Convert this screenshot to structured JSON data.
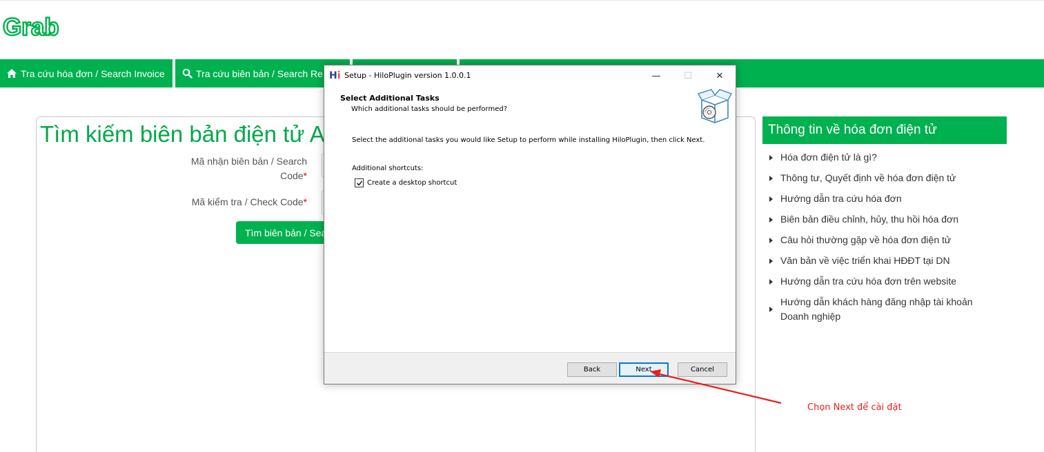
{
  "logo": {
    "text": "Grab",
    "color": "#00b14f"
  },
  "nav": {
    "items": [
      {
        "label": "Tra cứu hóa đơn / Search Invoice",
        "icon": "home-icon"
      },
      {
        "label": "Tra cứu biên bản / Search Re",
        "icon": "search-icon"
      }
    ]
  },
  "form": {
    "title": "Tìm kiếm biên bản điện tử A",
    "search_code_label_line1": "Mã nhận biên bản / Search",
    "search_code_label_line2": "Code",
    "check_code_label": "Mã kiểm tra / Check Code",
    "required_mark": "*",
    "search_button": "Tìm biên bản / Sea"
  },
  "sidebar": {
    "title": "Thông tin về hóa đơn điện tử",
    "items": [
      "Hóa đơn điện tử là gì?",
      "Thông tư, Quyết định về hóa đơn điện tử",
      "Hướng dẫn tra cứu hóa đơn",
      "Biên bản điều chỉnh, hủy, thu hồi hóa đơn",
      "Câu hỏi thường gặp về hóa đơn điện tử",
      "Văn bản về việc triển khai HĐĐT tại DN",
      "Hướng dẫn tra cứu hóa đơn trên website",
      "Hướng dẫn khách hàng đăng nhập tài khoản Doanh nghiệp"
    ]
  },
  "dialog": {
    "app_icon_h": "H",
    "app_icon_i": "i",
    "title": "Setup - HiloPlugin version 1.0.0.1",
    "minimize": "—",
    "maximize": "☐",
    "close": "✕",
    "heading": "Select Additional Tasks",
    "subheading": "Which additional tasks should be performed?",
    "instruction": "Select the additional tasks you would like Setup to perform while installing HiloPlugin, then click Next.",
    "shortcuts_label": "Additional shortcuts:",
    "checkbox_label": "Create a desktop shortcut",
    "checkbox_checked": true,
    "buttons": {
      "back": "Back",
      "next": "Next",
      "cancel": "Cancel"
    }
  },
  "annotation": {
    "text": "Chọn Next để cài đặt",
    "color": "#e8201d"
  },
  "colors": {
    "brand_green": "#00b14f",
    "title_green": "#00a84a",
    "required_red": "#e0000f"
  }
}
